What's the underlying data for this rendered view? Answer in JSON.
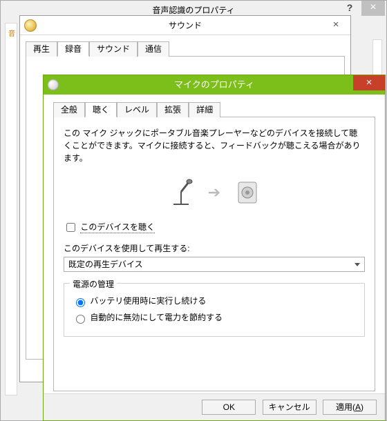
{
  "back_window": {
    "title": "音声認識のプロパティ"
  },
  "sound_window": {
    "title": "サウンド",
    "tabs": [
      "再生",
      "録音",
      "サウンド",
      "通信"
    ],
    "active_tab_index": 1
  },
  "mic_window": {
    "title": "マイクのプロパティ",
    "tabs": [
      "全般",
      "聴く",
      "レベル",
      "拡張",
      "詳細"
    ],
    "active_tab_index": 1,
    "description": "この マイク ジャックにポータブル音楽プレーヤーなどのデバイスを接続して聴くことができます。マイクに接続すると、フィードバックが聴こえる場合があります。",
    "listen_checkbox": {
      "label": "このデバイスを聴く",
      "checked": false
    },
    "playback_device": {
      "label": "このデバイスを使用して再生する:",
      "selected": "既定の再生デバイス"
    },
    "power_group": {
      "legend": "電源の管理",
      "options": [
        {
          "label": "バッテリ使用時に実行し続ける",
          "selected": true
        },
        {
          "label": "自動的に無効にして電力を節約する",
          "selected": false
        }
      ]
    },
    "buttons": {
      "ok": "OK",
      "cancel": "キャンセル",
      "apply_prefix": "適用(",
      "apply_key": "A",
      "apply_suffix": ")"
    }
  }
}
